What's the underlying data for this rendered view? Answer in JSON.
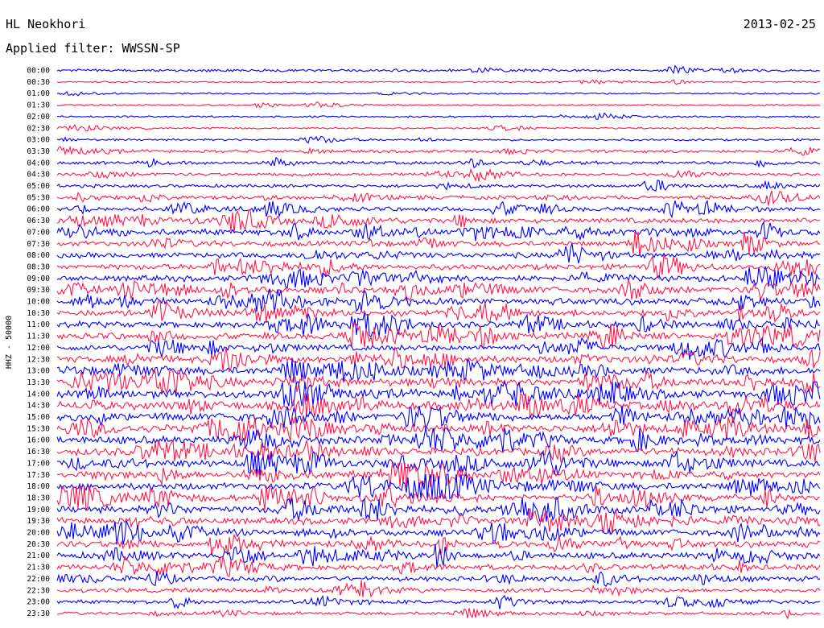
{
  "header": {
    "station": "HL Neokhori",
    "date": "2013-02-25",
    "filter_prefix": "Applied filter:",
    "filter_name": "WWSSN-SP"
  },
  "chart_data": {
    "type": "line",
    "title": "HL Neokhori",
    "subtitle": "Applied filter: WWSSN-SP",
    "ylabel": "HHZ - 50000",
    "xlabel": "",
    "row_interval_minutes": 30,
    "categories": [
      "00:00",
      "00:30",
      "01:00",
      "01:30",
      "02:00",
      "02:30",
      "03:00",
      "03:30",
      "04:00",
      "04:30",
      "05:00",
      "05:30",
      "06:00",
      "06:30",
      "07:00",
      "07:30",
      "08:00",
      "08:30",
      "09:00",
      "09:30",
      "10:00",
      "10:30",
      "11:00",
      "11:30",
      "12:00",
      "12:30",
      "13:00",
      "13:30",
      "14:00",
      "14:30",
      "15:00",
      "15:30",
      "16:00",
      "16:30",
      "17:00",
      "17:30",
      "18:00",
      "18:30",
      "19:00",
      "19:30",
      "20:00",
      "20:30",
      "21:00",
      "21:30",
      "22:00",
      "22:30",
      "23:00",
      "23:30"
    ],
    "trace_colors": [
      "#0000ff",
      "#ff1a4a"
    ],
    "relative_activity": [
      0.22,
      0.05,
      0.05,
      0.06,
      0.08,
      0.08,
      0.12,
      0.28,
      0.32,
      0.26,
      0.3,
      0.42,
      0.48,
      0.6,
      0.68,
      0.6,
      0.62,
      0.66,
      0.72,
      0.78,
      0.82,
      0.76,
      0.74,
      0.86,
      0.7,
      0.8,
      0.92,
      0.96,
      0.98,
      1.0,
      1.0,
      0.98,
      0.96,
      0.92,
      0.9,
      0.88,
      0.88,
      0.86,
      0.86,
      0.84,
      0.8,
      0.78,
      0.74,
      0.62,
      0.52,
      0.44,
      0.36,
      0.3
    ],
    "grid": false,
    "legend": "none"
  }
}
